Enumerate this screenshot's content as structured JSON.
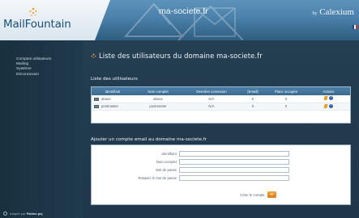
{
  "header": {
    "logo_text": "MailFountain",
    "domain_title": "ma-societe.fr",
    "brand_by": "by",
    "brand_name": "Calexium"
  },
  "sidebar": {
    "items": [
      {
        "label": "Comptes utilisateurs",
        "icon": "none"
      },
      {
        "label": "Mailing",
        "icon": "none"
      },
      {
        "label": "Système",
        "icon": "none"
      },
      {
        "label": "Déconnexion",
        "icon": "none"
      }
    ],
    "footer_prefix": "Adapté par",
    "footer_brand": "Fabien.pej"
  },
  "main": {
    "page_title": "Liste des utilisateurs du domaine ma-societe.fr",
    "users_section_title": "Liste des utilisateurs",
    "table": {
      "headers": [
        "Identifiant",
        "Nom complet",
        "Dernière connexion",
        "[Email]",
        "Place occupée",
        "Actions"
      ],
      "rows": [
        [
          "abuse",
          "abuse",
          "N/A",
          "0",
          "0",
          ""
        ],
        [
          "postmaster",
          "postmaster",
          "N/A",
          "0",
          "0",
          ""
        ]
      ],
      "row_icon": "user-icon",
      "action_icons": [
        "edit-icon",
        "help-icon"
      ]
    },
    "form_section_title": "Ajouter un compte email au domaine ma-societe.fr",
    "form": {
      "fields": [
        {
          "label": "Identifiant",
          "value": ""
        },
        {
          "label": "Nom complet",
          "value": ""
        },
        {
          "label": "Mot de passe",
          "value": ""
        },
        {
          "label": "Retapez le mot de passe",
          "value": ""
        }
      ],
      "submit_label": "Créer le compte",
      "submit_icon": "arrow-right-icon"
    }
  },
  "colors": {
    "header_blue": "#4a80a9",
    "background_navy": "#1d3447",
    "table_header_blue": "#4d7fa7",
    "accent_orange": "#e8882a"
  }
}
